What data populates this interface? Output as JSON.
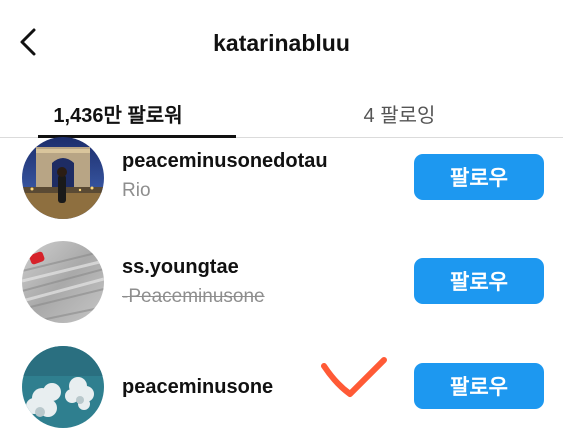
{
  "header": {
    "title": "katarinabluu",
    "back_icon": "chevron-left-icon"
  },
  "tabs": {
    "followers_label": "1,436만 팔로워",
    "following_label": "4 팔로잉",
    "active": "followers"
  },
  "users": [
    {
      "username": "peaceminusonedotau",
      "subtitle": "Rio",
      "button_label": "팔로우"
    },
    {
      "username": "ss.youngtae",
      "subtitle": "-Peaceminusone",
      "button_label": "팔로우"
    },
    {
      "username": "peaceminusone",
      "subtitle": "",
      "button_label": "팔로우"
    }
  ],
  "colors": {
    "follow_button": "#1d98f0",
    "checkmark": "#ff5a36",
    "secondary_text": "#8e8e8e"
  }
}
